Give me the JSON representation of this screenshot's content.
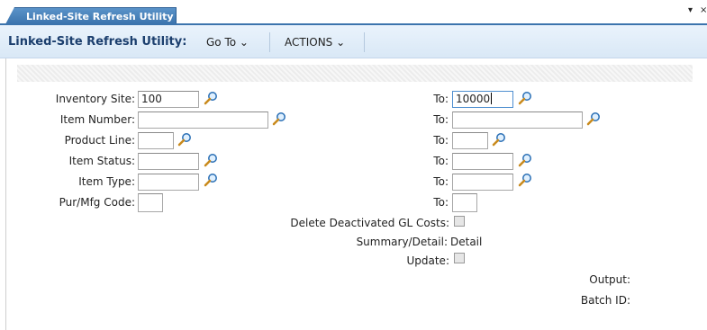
{
  "tab": {
    "title": "Linked-Site Refresh Utility"
  },
  "window_controls": {
    "menu_glyph": "▾",
    "close_glyph": "×"
  },
  "menubar": {
    "title": "Linked-Site Refresh Utility:",
    "goto_label": "Go To ⌄",
    "actions_label": "ACTIONS ⌄"
  },
  "form": {
    "inventory_site": {
      "label": "Inventory Site:",
      "value": "100",
      "to_label": "To:",
      "to_value": "10000"
    },
    "item_number": {
      "label": "Item Number:",
      "value": "",
      "to_label": "To:",
      "to_value": ""
    },
    "product_line": {
      "label": "Product Line:",
      "value": "",
      "to_label": "To:",
      "to_value": ""
    },
    "item_status": {
      "label": "Item Status:",
      "value": "",
      "to_label": "To:",
      "to_value": ""
    },
    "item_type": {
      "label": "Item Type:",
      "value": "",
      "to_label": "To:",
      "to_value": ""
    },
    "pur_mfg_code": {
      "label": "Pur/Mfg Code:",
      "value": "",
      "to_label": "To:",
      "to_value": ""
    },
    "delete_deactivated": {
      "label": "Delete Deactivated GL Costs:",
      "checked": false
    },
    "summary_detail": {
      "label": "Summary/Detail:",
      "value": "Detail"
    },
    "update": {
      "label": "Update:",
      "checked": false
    },
    "output": {
      "label": "Output:",
      "value": ""
    },
    "batch_id": {
      "label": "Batch ID:",
      "value": ""
    }
  },
  "icons": {
    "lookup": "magnifier-icon"
  },
  "colors": {
    "tab_blue": "#3c74ad",
    "title_blue": "#1c3f6e",
    "menubar_bg": "#e3eef9"
  }
}
